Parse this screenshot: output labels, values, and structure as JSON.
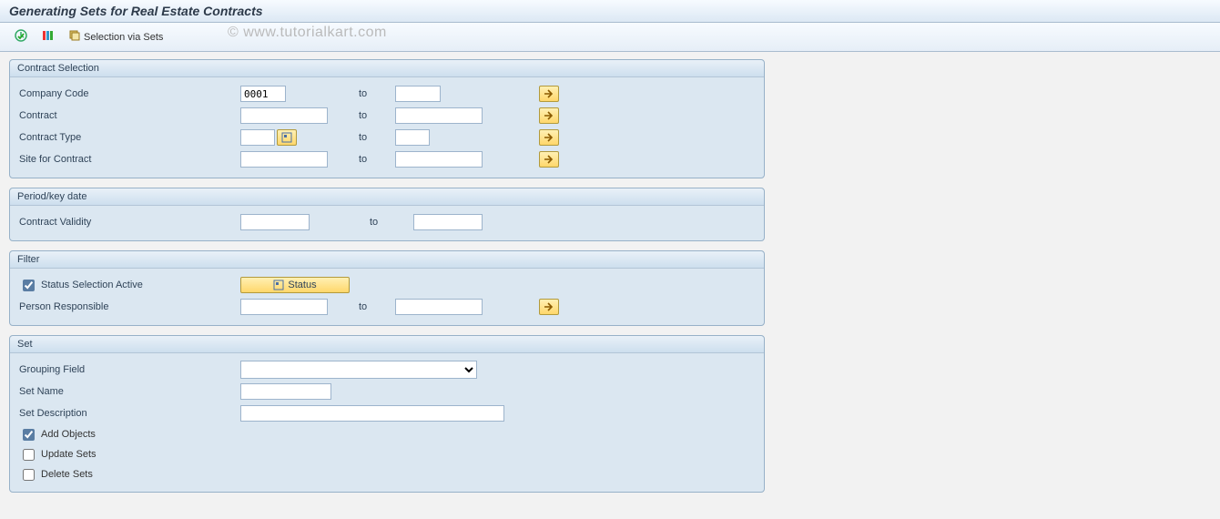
{
  "title": "Generating Sets for Real Estate Contracts",
  "watermark": "© www.tutorialkart.com",
  "toolbar": {
    "execute": "Execute",
    "variants": "Variants",
    "selection_via_sets": "Selection via Sets"
  },
  "groups": {
    "contract_selection": {
      "title": "Contract Selection",
      "rows": {
        "company_code": {
          "label": "Company Code",
          "from": "0001",
          "to_label": "to",
          "to": ""
        },
        "contract": {
          "label": "Contract",
          "from": "",
          "to_label": "to",
          "to": ""
        },
        "contract_type": {
          "label": "Contract Type",
          "from": "",
          "to_label": "to",
          "to": ""
        },
        "site": {
          "label": "Site for Contract",
          "from": "",
          "to_label": "to",
          "to": ""
        }
      }
    },
    "period": {
      "title": "Period/key date",
      "rows": {
        "validity": {
          "label": "Contract Validity",
          "from": "",
          "to_label": "to",
          "to": ""
        }
      }
    },
    "filter": {
      "title": "Filter",
      "status_active": {
        "label": "Status Selection Active",
        "checked": true
      },
      "status_button": "Status",
      "person": {
        "label": "Person Responsible",
        "from": "",
        "to_label": "to",
        "to": ""
      }
    },
    "set": {
      "title": "Set",
      "grouping_field": {
        "label": "Grouping Field",
        "value": ""
      },
      "set_name": {
        "label": "Set Name",
        "value": ""
      },
      "set_description": {
        "label": "Set Description",
        "value": ""
      },
      "add_objects": {
        "label": "Add Objects",
        "checked": true
      },
      "update_sets": {
        "label": "Update Sets",
        "checked": false
      },
      "delete_sets": {
        "label": "Delete Sets",
        "checked": false
      }
    }
  }
}
